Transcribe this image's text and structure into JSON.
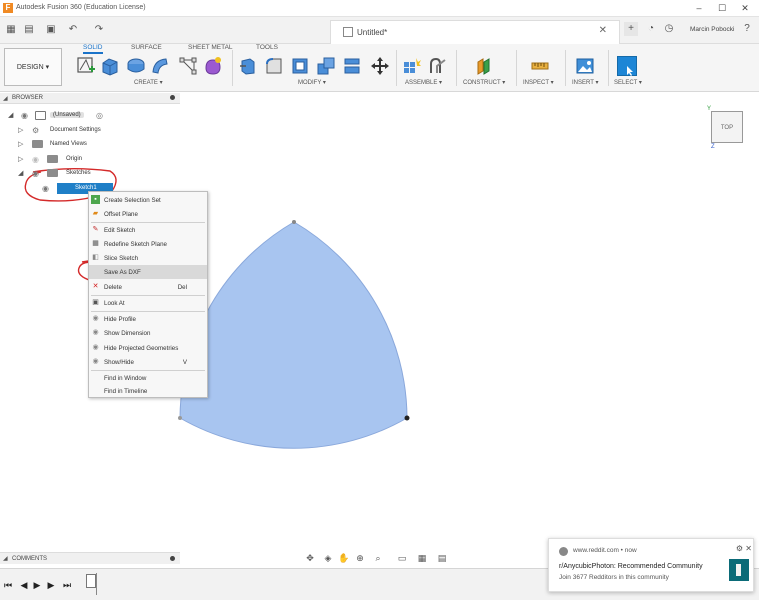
{
  "window": {
    "title": "Autodesk Fusion 360 (Education License)",
    "logo": "F"
  },
  "document": {
    "title": "Untitled*",
    "user": "Marcin Pobocki"
  },
  "ribbon": {
    "workspace": "DESIGN",
    "tabs": [
      "SOLID",
      "SURFACE",
      "SHEET METAL",
      "TOOLS"
    ],
    "active_tab": "SOLID",
    "groups": [
      "CREATE",
      "MODIFY",
      "ASSEMBLE",
      "CONSTRUCT",
      "INSPECT",
      "INSERT",
      "SELECT"
    ],
    "accent_color": "#1a73c9"
  },
  "browser": {
    "title": "BROWSER",
    "root": "(Unsaved)",
    "items": [
      "Document Settings",
      "Named Views",
      "Origin",
      "Sketches"
    ],
    "selected_sketch": "Sketch1"
  },
  "context_menu": {
    "items": [
      {
        "label": "Create Selection Set",
        "icon": "selection-set-icon",
        "shortcut": ""
      },
      {
        "label": "Offset Plane",
        "icon": "offset-plane-icon",
        "shortcut": ""
      },
      {
        "label": "Edit Sketch",
        "icon": "edit-sketch-icon",
        "shortcut": ""
      },
      {
        "label": "Redefine Sketch Plane",
        "icon": "redefine-plane-icon",
        "shortcut": ""
      },
      {
        "label": "Slice Sketch",
        "icon": "slice-sketch-icon",
        "shortcut": ""
      },
      {
        "label": "Save As DXF",
        "icon": "",
        "shortcut": ""
      },
      {
        "label": "Delete",
        "icon": "delete-icon",
        "shortcut": "Del"
      },
      {
        "label": "Look At",
        "icon": "look-at-icon",
        "shortcut": ""
      },
      {
        "label": "Hide Profile",
        "icon": "eye-icon",
        "shortcut": ""
      },
      {
        "label": "Show Dimension",
        "icon": "eye-icon",
        "shortcut": ""
      },
      {
        "label": "Hide Projected Geometries",
        "icon": "eye-icon",
        "shortcut": ""
      },
      {
        "label": "Show/Hide",
        "icon": "eye-icon",
        "shortcut": "V"
      },
      {
        "label": "Find in Window",
        "icon": "",
        "shortcut": ""
      },
      {
        "label": "Find in Timeline",
        "icon": "",
        "shortcut": ""
      }
    ]
  },
  "canvas": {
    "shape_fill": "#a8c5f0",
    "shape_stroke": "#8aa8db",
    "annotation_color": "#d42a2a"
  },
  "viewcube": {
    "face": "TOP",
    "axis_y": "Y",
    "axis_z": "Z"
  },
  "comments": {
    "title": "COMMENTS"
  },
  "notification": {
    "source": "www.reddit.com • now",
    "title": "r/AnycubicPhoton: Recommended Community",
    "body": "Join 3677 Redditors in this community"
  }
}
